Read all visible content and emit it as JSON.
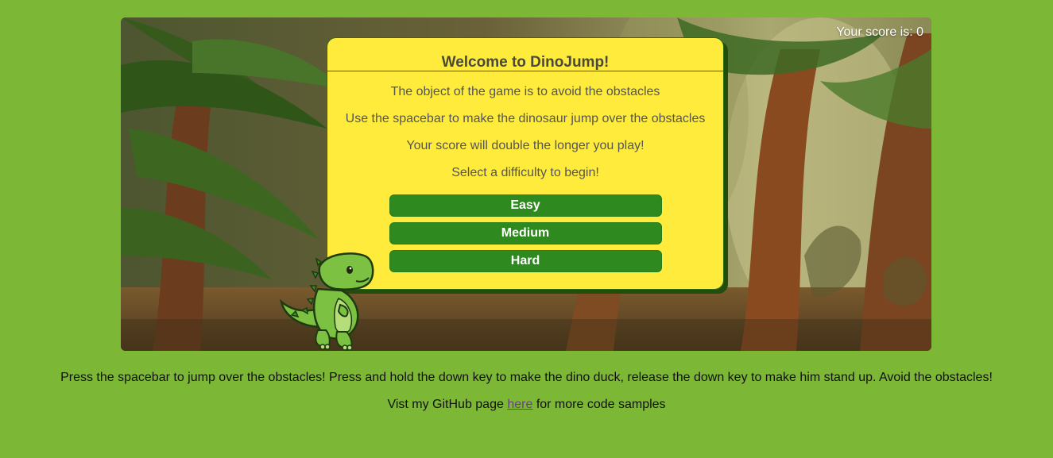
{
  "score": {
    "label": "Your score is: 0"
  },
  "modal": {
    "title": "Welcome to DinoJump!",
    "lines": [
      "The object of the game is to avoid the obstacles",
      "Use the spacebar to make the dinosaur jump over the obstacles",
      "Your score will double the longer you play!",
      "Select a difficulty to begin!"
    ],
    "buttons": {
      "easy": "Easy",
      "medium": "Medium",
      "hard": "Hard"
    }
  },
  "footer": {
    "instructions": "Press the spacebar to jump over the obstacles! Press and hold the down key to make the dino duck, release the down key to make him stand up. Avoid the obstacles!",
    "github_prefix": "Vist my GitHub page",
    "github_link": "here",
    "github_suffix": "for more code samples"
  },
  "colors": {
    "page_bg": "#7db736",
    "modal_bg": "#ffeb3b",
    "button_bg": "#2e8a1e",
    "dino_green": "#7cc142"
  },
  "icons": {
    "player": "dinosaur-sprite"
  }
}
